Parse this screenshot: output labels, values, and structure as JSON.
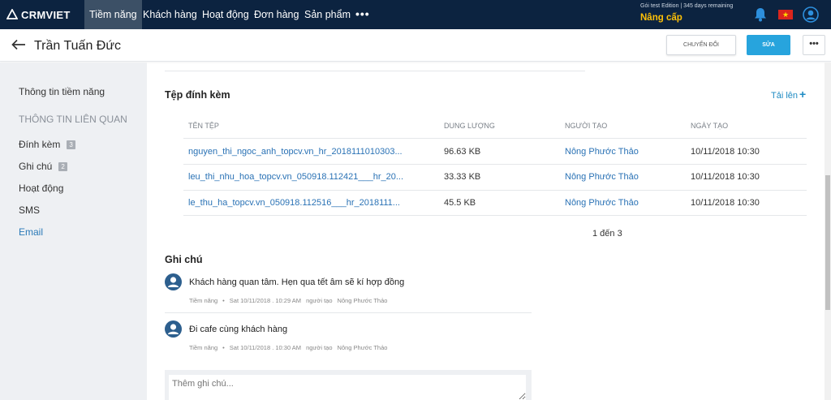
{
  "nav": {
    "logo": "CRMVIET",
    "items": [
      "Tiềm năng",
      "Khách hàng",
      "Hoạt động",
      "Đơn hàng",
      "Sản phẩm"
    ],
    "more": "•••",
    "trial_text": "Gói test Edition | 345 days remaining",
    "upgrade": "Nâng cấp",
    "flag_star": "★",
    "icons": [
      "bell-icon",
      "flag-vn-icon",
      "user-avatar-icon"
    ]
  },
  "header": {
    "title": "Trần Tuấn Đức",
    "convert_label": "CHUYỂN ĐỔI",
    "edit_label": "SỬA",
    "more_label": "•••"
  },
  "sidebar": {
    "info": "Thông tin tiềm năng",
    "related_heading": "THÔNG TIN LIÊN QUAN",
    "attachments": "Đính kèm",
    "attachments_count": "3",
    "notes": "Ghi chú",
    "notes_count": "2",
    "activities": "Hoạt động",
    "sms": "SMS",
    "email": "Email"
  },
  "attachments": {
    "title": "Tệp đính kèm",
    "upload": "Tải lên",
    "upload_icon": "+",
    "columns": [
      "TÊN TỆP",
      "DUNG LƯỢNG",
      "NGƯỜI TẠO",
      "NGÀY TẠO"
    ],
    "rows": [
      {
        "name": "nguyen_thi_ngoc_anh_topcv.vn_hr_2018111010303...",
        "size": "96.63 KB",
        "creator": "Nông Phước Thảo",
        "date": "10/11/2018 10:30"
      },
      {
        "name": "leu_thi_nhu_hoa_topcv.vn_050918.112421___hr_20...",
        "size": "33.33 KB",
        "creator": "Nông Phước Thảo",
        "date": "10/11/2018 10:30"
      },
      {
        "name": "le_thu_ha_topcv.vn_050918.112516___hr_2018111...",
        "size": "45.5 KB",
        "creator": "Nông Phước Thảo",
        "date": "10/11/2018 10:30"
      }
    ],
    "pager": "1 đến 3"
  },
  "notes": {
    "title": "Ghi chú",
    "items": [
      {
        "text": "Khách hàng quan tâm. Hẹn qua tết âm sẽ kí hợp đồng",
        "tag": "Tiềm năng",
        "dot": "•",
        "time": "Sat 10/11/2018 . 10:29 AM",
        "by_label": "người tạo",
        "author": "Nông Phước Thảo"
      },
      {
        "text": "Đi cafe cùng khách hàng",
        "tag": "Tiềm năng",
        "dot": "•",
        "time": "Sat 10/11/2018 . 10:30 AM",
        "by_label": "người tạo",
        "author": "Nông Phước Thảo"
      }
    ],
    "placeholder": "Thêm ghi chú..."
  }
}
